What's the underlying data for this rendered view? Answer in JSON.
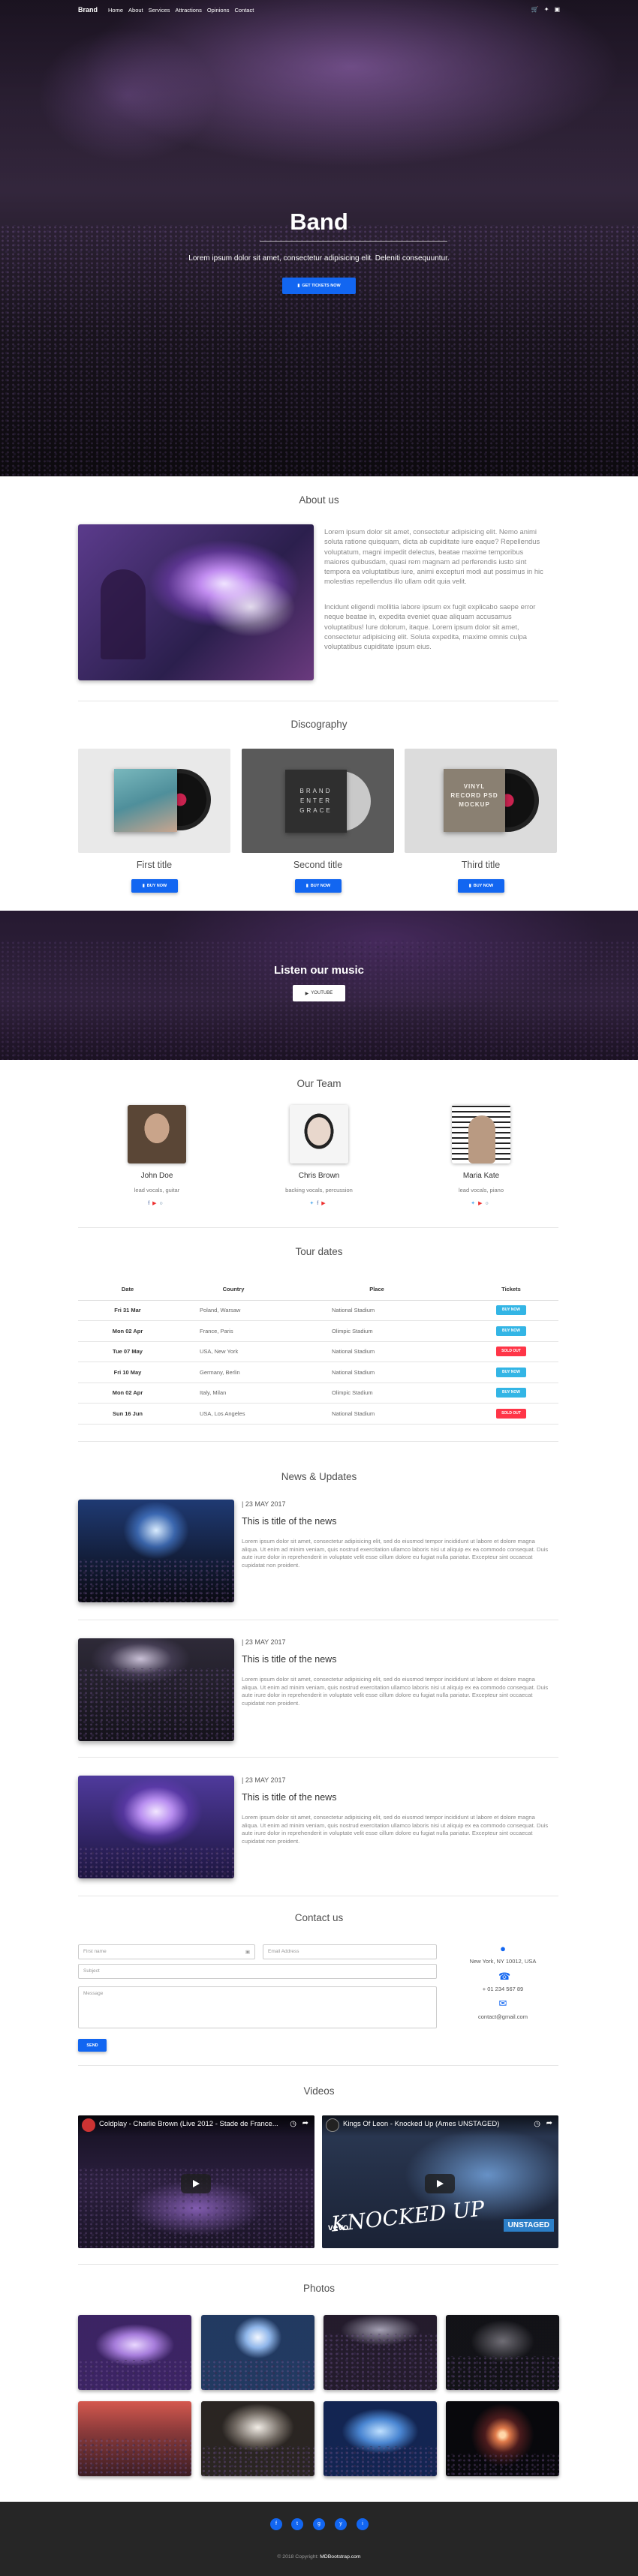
{
  "nav": {
    "brand": "Brand",
    "links": [
      "Home",
      "About",
      "Services",
      "Attractions",
      "Opinions",
      "Contact"
    ],
    "icons": [
      "cart-icon",
      "twitter-icon",
      "instagram-icon"
    ]
  },
  "hero": {
    "title": "Band",
    "subtitle": "Lorem ipsum dolor sit amet, consectetur adipisicing elit. Deleniti consequuntur.",
    "button": "GET TICKETS NOW"
  },
  "about": {
    "title": "About us",
    "paragraphs": [
      "Lorem ipsum dolor sit amet, consectetur adipisicing elit. Nemo animi soluta ratione quisquam, dicta ab cupiditate iure eaque? Repellendus voluptatum, magni impedit delectus, beatae maxime temporibus maiores quibusdam, quasi rem magnam ad perferendis iusto sint tempora ea voluptatibus iure, animi excepturi modi aut possimus in hic molestias repellendus illo ullam odit quia velit.",
      "Incidunt eligendi mollitia labore ipsum ex fugit explicabo saepe error neque beatae in, expedita eveniet quae aliquam accusamus voluptatibus! Iure dolorum, itaque. Lorem ipsum dolor sit amet, consectetur adipisicing elit. Soluta expedita, maxime omnis culpa voluptatibus cupiditate ipsum eius."
    ]
  },
  "discography": {
    "title": "Discography",
    "items": [
      {
        "title": "First title",
        "button": "BUY NOW"
      },
      {
        "title": "Second title",
        "button": "BUY NOW"
      },
      {
        "title": "Third title",
        "button": "BUY NOW"
      }
    ]
  },
  "listen": {
    "title": "Listen our music",
    "button": "YOUTUBE"
  },
  "team": {
    "title": "Our Team",
    "members": [
      {
        "name": "John Doe",
        "role": "lead vocals, guitar"
      },
      {
        "name": "Chris Brown",
        "role": "backing vocals, percussion"
      },
      {
        "name": "Maria Kate",
        "role": "lead vocals, piano"
      }
    ]
  },
  "tour": {
    "title": "Tour dates",
    "headers": [
      "Date",
      "Country",
      "Place",
      "Tickets"
    ],
    "rows": [
      {
        "date": "Fri 31 Mar",
        "country": "Poland, Warsaw",
        "place": "National Stadium",
        "ticket": "BUY NOW",
        "status": "available"
      },
      {
        "date": "Mon 02 Apr",
        "country": "France, Paris",
        "place": "Olimpic Stadium",
        "ticket": "BUY NOW",
        "status": "available"
      },
      {
        "date": "Tue 07 May",
        "country": "USA, New York",
        "place": "National Stadium",
        "ticket": "SOLD OUT",
        "status": "sold"
      },
      {
        "date": "Fri 10 May",
        "country": "Germany, Berlin",
        "place": "National Stadium",
        "ticket": "BUY NOW",
        "status": "available"
      },
      {
        "date": "Mon 02 Apr",
        "country": "Italy, Milan",
        "place": "Olimpic Stadium",
        "ticket": "BUY NOW",
        "status": "available"
      },
      {
        "date": "Sun 16 Jun",
        "country": "USA, Los Angeles",
        "place": "National Stadium",
        "ticket": "SOLD OUT",
        "status": "sold"
      }
    ]
  },
  "news": {
    "title": "News & Updates",
    "items": [
      {
        "date": "23 MAY 2017",
        "title": "This is title of the news",
        "body": "Lorem ipsum dolor sit amet, consectetur adipisicing elit, sed do eiusmod tempor incididunt ut labore et dolore magna aliqua. Ut enim ad minim veniam, quis nostrud exercitation ullamco laboris nisi ut aliquip ex ea commodo consequat. Duis aute irure dolor in reprehenderit in voluptate velit esse cillum dolore eu fugiat nulla pariatur. Excepteur sint occaecat cupidatat non proident."
      },
      {
        "date": "23 MAY 2017",
        "title": "This is title of the news",
        "body": "Lorem ipsum dolor sit amet, consectetur adipisicing elit, sed do eiusmod tempor incididunt ut labore et dolore magna aliqua. Ut enim ad minim veniam, quis nostrud exercitation ullamco laboris nisi ut aliquip ex ea commodo consequat. Duis aute irure dolor in reprehenderit in voluptate velit esse cillum dolore eu fugiat nulla pariatur. Excepteur sint occaecat cupidatat non proident."
      },
      {
        "date": "23 MAY 2017",
        "title": "This is title of the news",
        "body": "Lorem ipsum dolor sit amet, consectetur adipisicing elit, sed do eiusmod tempor incididunt ut labore et dolore magna aliqua. Ut enim ad minim veniam, quis nostrud exercitation ullamco laboris nisi ut aliquip ex ea commodo consequat. Duis aute irure dolor in reprehenderit in voluptate velit esse cillum dolore eu fugiat nulla pariatur. Excepteur sint occaecat cupidatat non proident."
      }
    ]
  },
  "contact": {
    "title": "Contact us",
    "placeholders": {
      "name": "First name",
      "email": "Email Address",
      "subject": "Subject",
      "message": "Message"
    },
    "send": "SEND",
    "address": "New York, NY 10012, USA",
    "phone": "+ 01 234 567 89",
    "email": "contact@gmail.com"
  },
  "videos": {
    "title": "Videos",
    "items": [
      "Coldplay - Charlie Brown (Live 2012 - Stade de France...",
      "Kings Of Leon - Knocked Up (Ames UNSTAGED)"
    ],
    "overlay": {
      "vevo": "vevo",
      "knocked": "KNOCKED UP",
      "unstaged": "UNSTAGED"
    }
  },
  "photos": {
    "title": "Photos"
  },
  "discs": {
    "second": "BRAND ENTER GRACE",
    "third": "VINYL RECORD PSD MOCKUP"
  },
  "footer": {
    "social": [
      "f",
      "t",
      "g",
      "y",
      "i"
    ],
    "copyright": "© 2018 Copyright:",
    "link": "MDBootstrap.com"
  }
}
